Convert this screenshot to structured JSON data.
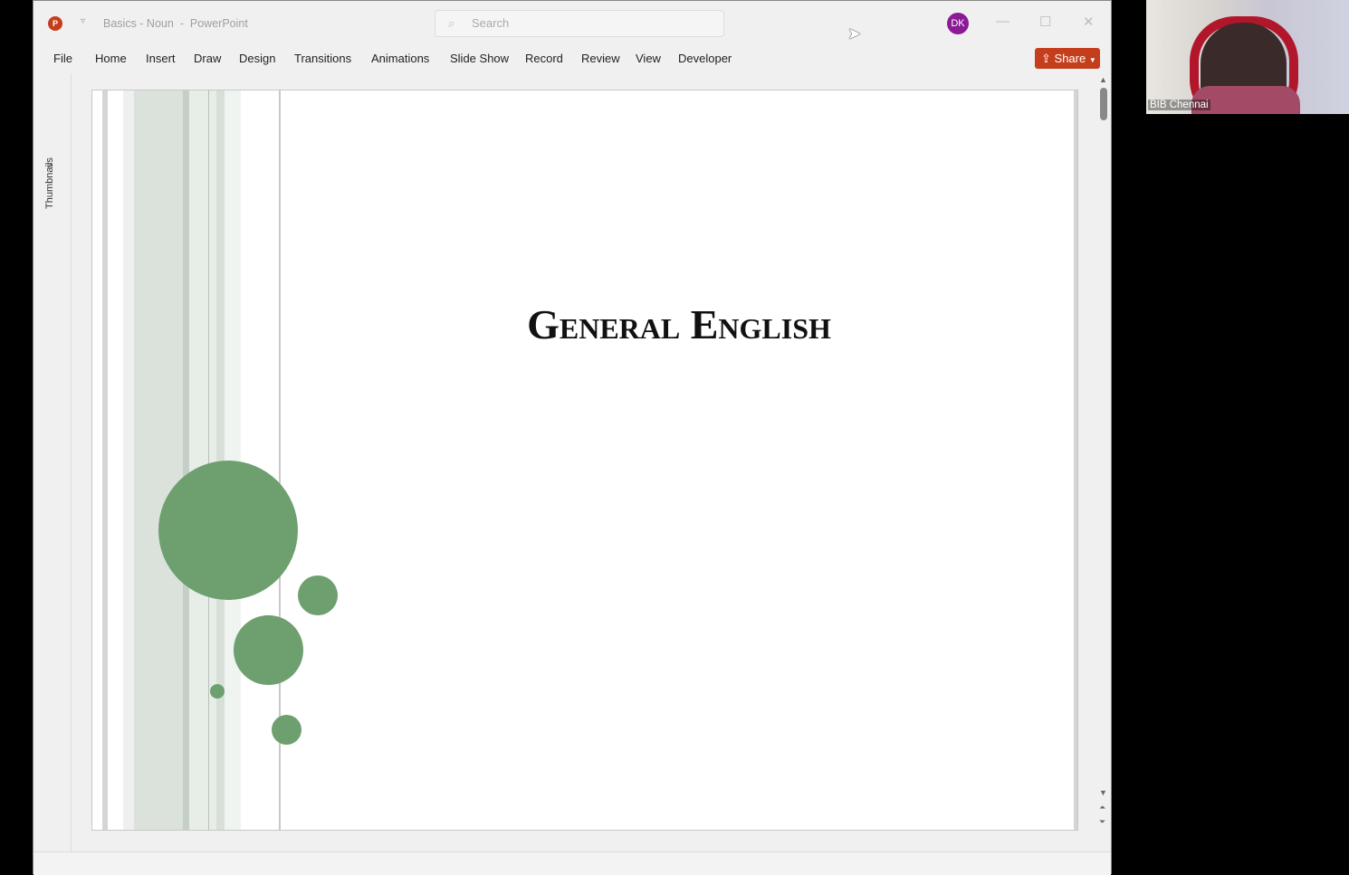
{
  "window": {
    "title": "Basics - Noun",
    "app": "PowerPoint",
    "title_separator": "-",
    "search_placeholder": "Search",
    "user_initials": "DK"
  },
  "ribbon": {
    "tabs": [
      "File",
      "Home",
      "Insert",
      "Draw",
      "Design",
      "Transitions",
      "Animations",
      "Slide Show",
      "Record",
      "Review",
      "View",
      "Developer"
    ],
    "share_label": "Share"
  },
  "side_panel": {
    "label": "Thumbnails"
  },
  "slide": {
    "title": "General English",
    "accent_color": "#6d9f6f"
  },
  "video": {
    "participant_name": "BIB Chennai"
  }
}
